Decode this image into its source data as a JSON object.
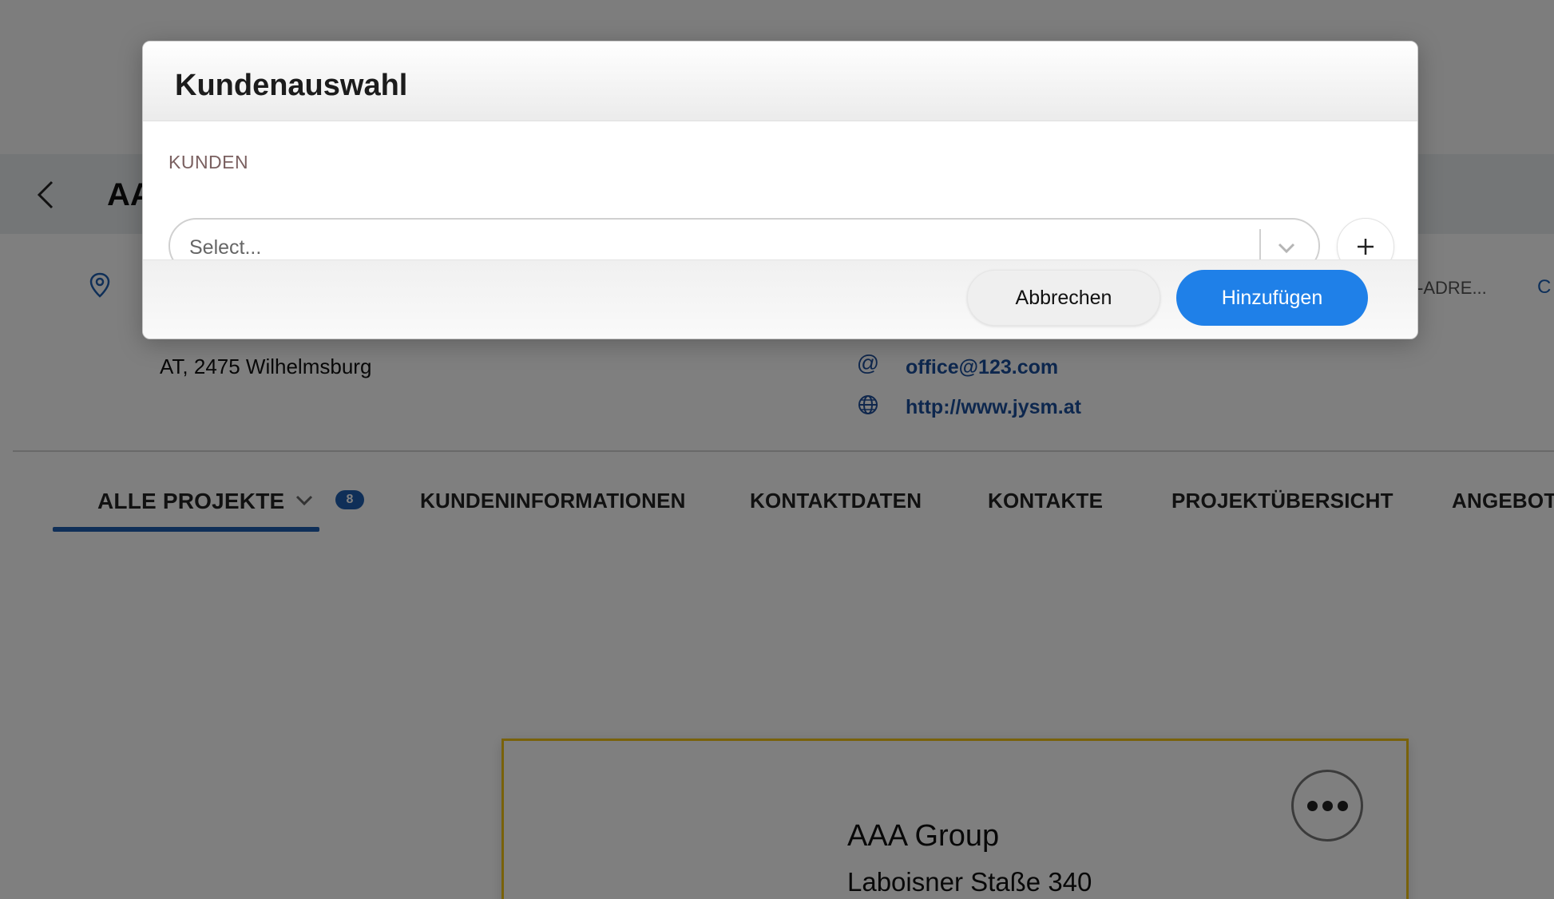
{
  "header": {
    "title_visible": "AA",
    "back_icon": "chevron-left-icon"
  },
  "details": {
    "address": "AT, 2475 Wilhelmsburg",
    "email_label_truncated": "-ADRE...",
    "truncated_link": "C",
    "email": "office@123.com",
    "website": "http://www.jysm.at"
  },
  "tabs": {
    "items": [
      {
        "label": "ALLE PROJEKTE",
        "active": true
      },
      {
        "label": "KUNDENINFORMATIONEN"
      },
      {
        "label": "KONTAKTDATEN"
      },
      {
        "label": "KONTAKTE"
      },
      {
        "label": "PROJEKTÜBERSICHT"
      },
      {
        "label": "ANGEBOT"
      }
    ],
    "badge": "8"
  },
  "card": {
    "name": "AAA Group",
    "street": "Laboisner Staße 340",
    "accent_color": "#f3c515"
  },
  "modal": {
    "title": "Kundenauswahl",
    "field_label": "KUNDEN",
    "select_placeholder": "Select...",
    "add_icon": "plus-icon",
    "cancel_label": "Abbrechen",
    "submit_label": "Hinzufügen",
    "submit_color": "#1f80e8"
  }
}
